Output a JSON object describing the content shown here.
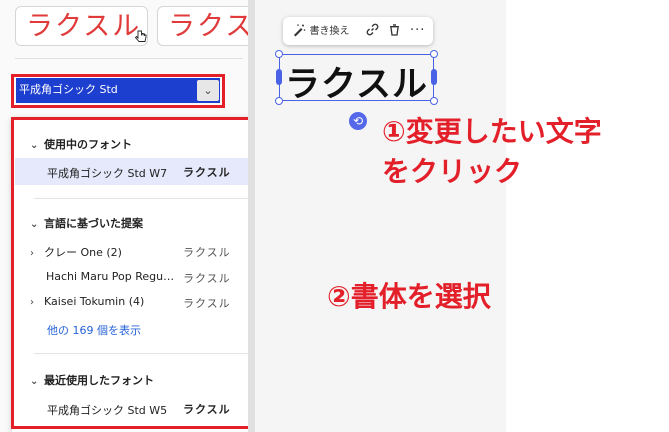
{
  "font_samples": {
    "tile1": "ラクスル",
    "tile2": "ラクス"
  },
  "font_select": {
    "value": "平成角ゴシック Std",
    "caret": "⌄"
  },
  "dropdown": {
    "section_in_use": {
      "title": "使用中のフォント",
      "items": [
        {
          "name": "平成角ゴシック Std W7",
          "sample": "ラクスル"
        }
      ]
    },
    "section_suggest": {
      "title": "言語に基づいた提案",
      "items": [
        {
          "name": "クレー One (2)",
          "sample": "ラクスル"
        },
        {
          "name": "Hachi Maru Pop Regu…",
          "sample": "ラクスル"
        },
        {
          "name": "Kaisei Tokumin (4)",
          "sample": "ラクスル"
        }
      ],
      "more_link": "他の 169 個を表示"
    },
    "section_recent": {
      "title": "最近使用したフォント",
      "items": [
        {
          "name": "平成角ゴシック Std W5",
          "sample": "ラクスル"
        }
      ]
    }
  },
  "canvas": {
    "toolbar": {
      "rewrite_label": "書き換え"
    },
    "text": "ラクスル"
  },
  "annotations": {
    "step1_line1": "①変更したい文字",
    "step1_line2": "をクリック",
    "step2": "②書体を選択"
  },
  "colors": {
    "annotation_red": "#e3202a",
    "selection_blue": "#4a63e6",
    "select_fill": "#1d3fcf",
    "link_blue": "#2662d9"
  }
}
